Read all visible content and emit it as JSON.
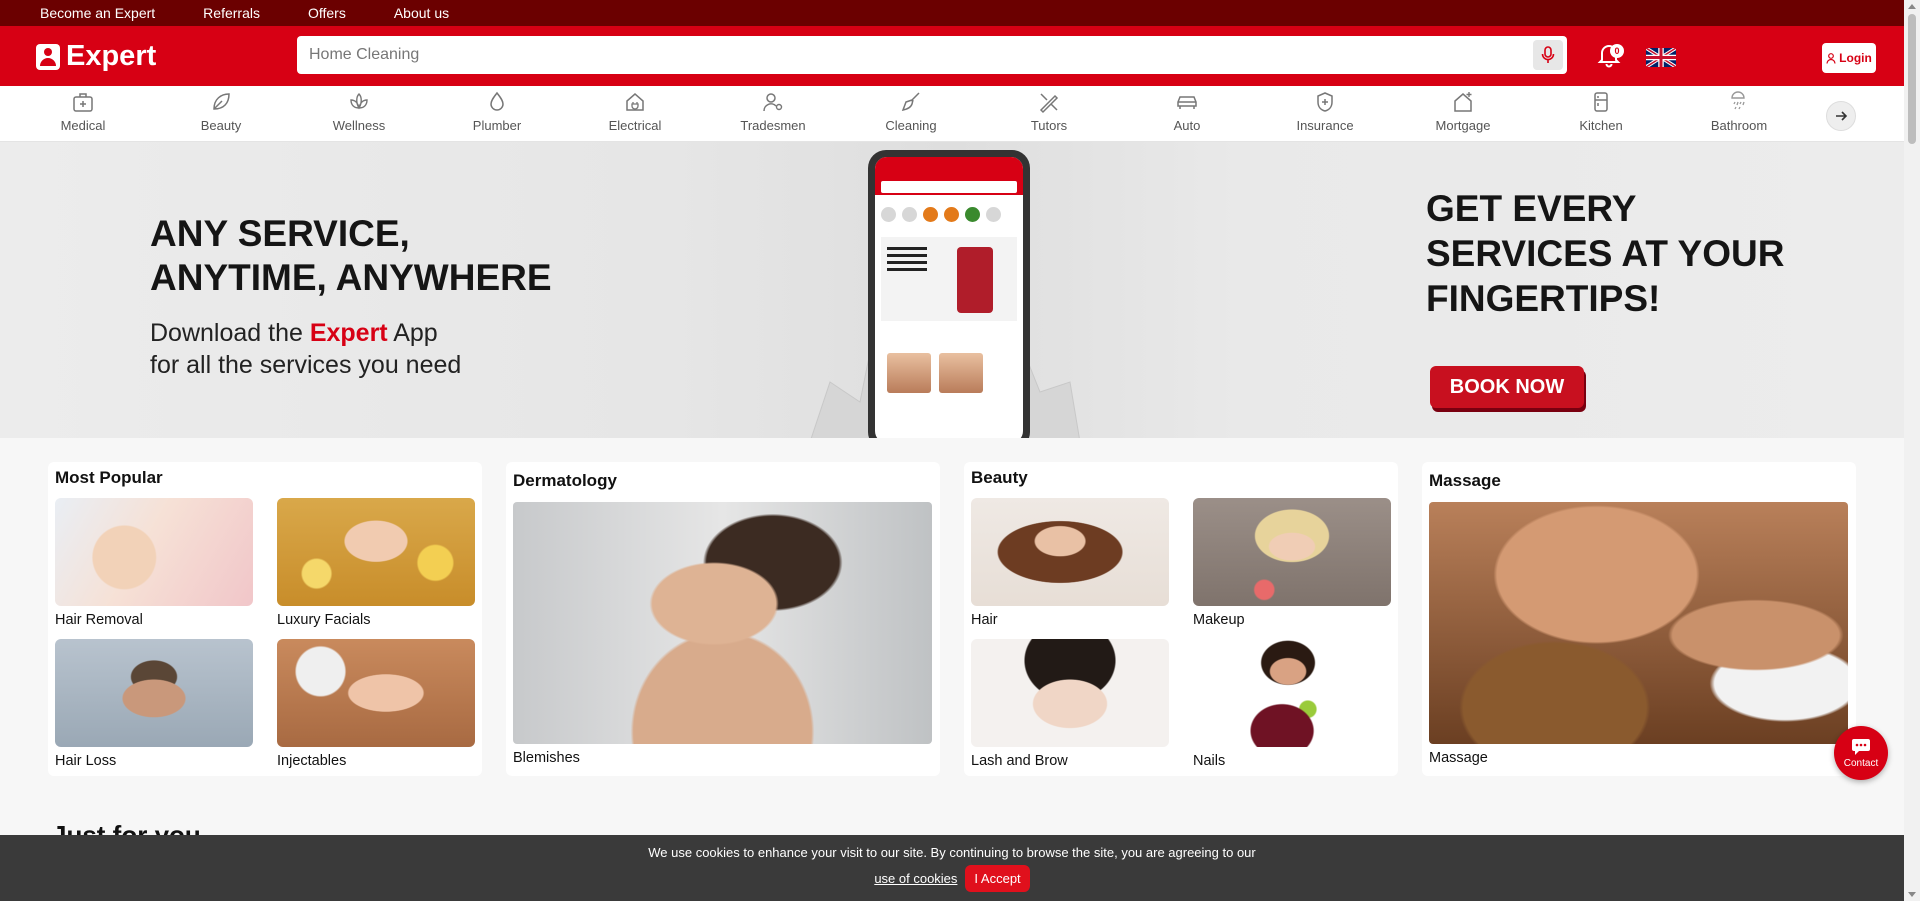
{
  "topbar": {
    "links": [
      "Become an Expert",
      "Referrals",
      "Offers",
      "About us"
    ]
  },
  "header": {
    "brand": "Expert",
    "search_placeholder": "Home Cleaning",
    "notification_count": "0",
    "login_label": "Login",
    "icons": {
      "mic": "microphone-icon",
      "bell": "bell-icon",
      "flag": "uk-flag-icon",
      "user": "user-icon"
    }
  },
  "categories": [
    {
      "label": "Medical",
      "icon": "medical-kit-icon"
    },
    {
      "label": "Beauty",
      "icon": "leaf-icon"
    },
    {
      "label": "Wellness",
      "icon": "lotus-icon"
    },
    {
      "label": "Plumber",
      "icon": "droplet-icon"
    },
    {
      "label": "Electrical",
      "icon": "plug-icon"
    },
    {
      "label": "Tradesmen",
      "icon": "worker-icon"
    },
    {
      "label": "Cleaning",
      "icon": "brush-icon"
    },
    {
      "label": "Tutors",
      "icon": "pencil-ruler-icon"
    },
    {
      "label": "Auto",
      "icon": "car-icon"
    },
    {
      "label": "Insurance",
      "icon": "shield-plus-icon"
    },
    {
      "label": "Mortgage",
      "icon": "house-plus-icon"
    },
    {
      "label": "Kitchen",
      "icon": "fridge-icon"
    },
    {
      "label": "Bathroom",
      "icon": "shower-icon"
    }
  ],
  "banner": {
    "headline": "ANY SERVICE,\nANYTIME, ANYWHERE",
    "sub_pre": "Download the ",
    "sub_brand": "Expert",
    "sub_post": " App",
    "sub_line2": "for all the services you need",
    "right_headline": "GET EVERY\nSERVICES AT YOUR\nFINGERTIPS!",
    "cta": "BOOK NOW"
  },
  "sections": {
    "most_popular": {
      "title": "Most Popular",
      "items": [
        "Hair Removal",
        "Luxury Facials",
        "Hair Loss",
        "Injectables"
      ]
    },
    "dermatology": {
      "title": "Dermatology",
      "items": [
        "Blemishes"
      ]
    },
    "beauty": {
      "title": "Beauty",
      "items": [
        "Hair",
        "Makeup",
        "Lash and Brow",
        "Nails"
      ]
    },
    "massage": {
      "title": "Massage",
      "items": [
        "Massage"
      ]
    }
  },
  "just_for_you": "Just for you",
  "contact_label": "Contact",
  "cookie": {
    "message": "We use cookies to enhance your visit to our site. By continuing to browse the site, you are agreeing to our",
    "link": "use of cookies",
    "accept": "I Accept"
  },
  "colors": {
    "brand_red": "#d70014",
    "top_strip": "#6b0000",
    "cookie_bg": "#3a3a3a"
  }
}
